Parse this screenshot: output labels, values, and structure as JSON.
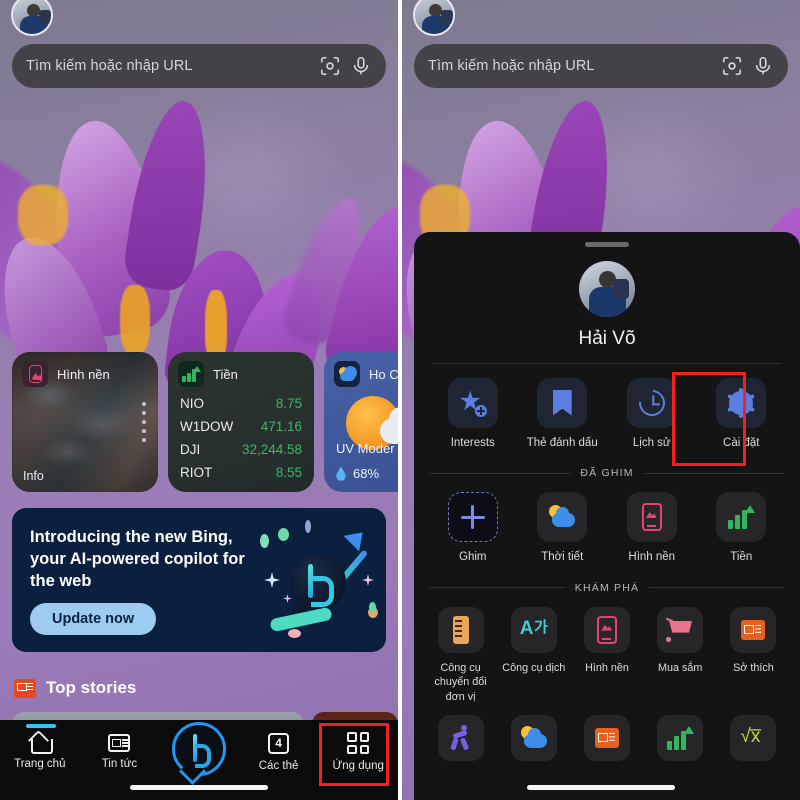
{
  "left_panel": {
    "search": {
      "placeholder": "Tìm kiếm hoặc nhập URL",
      "lens_icon": "lens-icon",
      "mic_icon": "microphone-icon"
    },
    "avatar_name": "user-avatar",
    "widgets": [
      {
        "type": "wallpaper",
        "title": "Hình nền",
        "footer": "Info",
        "icon": "wallpaper-icon"
      },
      {
        "type": "money",
        "title": "Tiền",
        "icon": "stocks-icon",
        "rows": [
          {
            "symbol": "NIO",
            "value": "8.75"
          },
          {
            "symbol": "W1DOW",
            "value": "471.16"
          },
          {
            "symbol": "DJI",
            "value": "32,244.58"
          },
          {
            "symbol": "RIOT",
            "value": "8.55"
          }
        ]
      },
      {
        "type": "weather",
        "title": "Ho C",
        "icon": "weather-icon",
        "uv": "UV Moder",
        "humidity": "68%"
      }
    ],
    "promo": {
      "headline": "Introducing the new Bing, your AI-powered copilot for the web",
      "button": "Update now",
      "icon": "bing-logo-icon"
    },
    "stories": {
      "label": "Top stories",
      "icon": "news-icon"
    },
    "nav": [
      {
        "label": "Trang chủ",
        "icon": "home-icon",
        "active": true
      },
      {
        "label": "Tin tức",
        "icon": "news-icon"
      },
      {
        "label": "",
        "icon": "bing-chat-icon"
      },
      {
        "label": "Các thẻ",
        "icon": "tabs-icon",
        "badge": "4"
      },
      {
        "label": "Ứng dụng",
        "icon": "apps-grid-icon",
        "highlighted": true
      }
    ]
  },
  "right_panel": {
    "search": {
      "placeholder": "Tìm kiếm hoặc nhập URL",
      "lens_icon": "lens-icon",
      "mic_icon": "microphone-icon"
    },
    "sheet": {
      "grabber": "drag-handle",
      "profile_name": "Hải Võ",
      "quick_actions": [
        {
          "label": "Interests",
          "icon": "star-plus-icon"
        },
        {
          "label": "Thẻ đánh dấu",
          "icon": "bookmark-icon"
        },
        {
          "label": "Lịch sử",
          "icon": "history-icon"
        },
        {
          "label": "Cài đặt",
          "icon": "gear-icon",
          "highlighted": true
        }
      ],
      "pinned_section": "ĐÃ GHIM",
      "pinned": [
        {
          "label": "Ghim",
          "icon": "plus-icon"
        },
        {
          "label": "Thời tiết",
          "icon": "weather-icon"
        },
        {
          "label": "Hình nền",
          "icon": "wallpaper-icon"
        },
        {
          "label": "Tiền",
          "icon": "stocks-icon"
        }
      ],
      "explore_section": "KHÁM PHÁ",
      "explore": [
        {
          "label": "Công cụ chuyển đổi đơn vị",
          "icon": "ruler-icon"
        },
        {
          "label": "Công cụ dịch",
          "icon": "translate-icon"
        },
        {
          "label": "Hình nền",
          "icon": "wallpaper-icon"
        },
        {
          "label": "Mua sắm",
          "icon": "cart-icon"
        },
        {
          "label": "Sở thích",
          "icon": "news-icon"
        }
      ],
      "explore_row2": [
        {
          "icon": "running-icon"
        },
        {
          "icon": "weather-icon"
        },
        {
          "icon": "news-icon"
        },
        {
          "icon": "stocks-icon"
        },
        {
          "icon": "math-icon"
        }
      ]
    }
  },
  "colors": {
    "highlight": "#f41f1f",
    "stock_green": "#3fb46a",
    "accent_blue": "#5b7fe0",
    "promo_bg": "#0b1f3f",
    "promo_button": "#9ecbf0"
  }
}
